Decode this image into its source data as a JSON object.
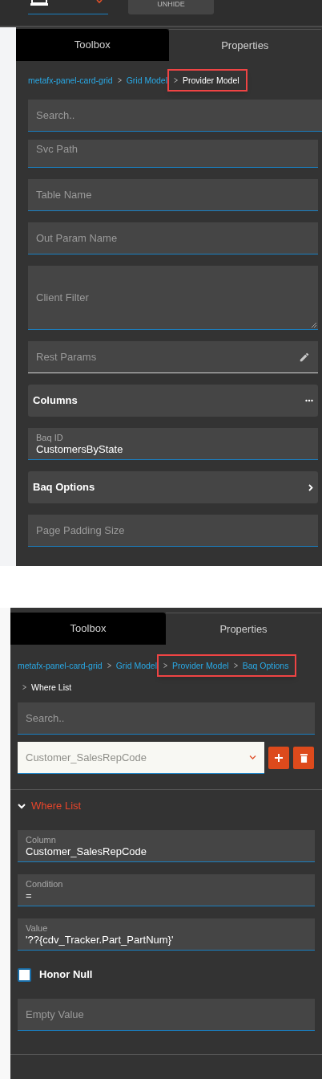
{
  "top_panel": {
    "toolbar": {
      "unhide_button": "UNHIDE"
    },
    "tabs": [
      {
        "label": "Toolbox",
        "selected": false
      },
      {
        "label": "Properties",
        "selected": true
      }
    ],
    "breadcrumbs": [
      {
        "label": "metafx-panel-card-grid",
        "current": false,
        "highlighted": false
      },
      {
        "label": "Grid Model",
        "current": false,
        "highlighted": false
      },
      {
        "label": "Provider Model",
        "current": true,
        "highlighted": true
      }
    ],
    "search": {
      "placeholder": "Search.."
    },
    "fields": [
      {
        "kind": "text",
        "placeholder": "Svc Path"
      },
      {
        "kind": "text",
        "placeholder": "Table Name"
      },
      {
        "kind": "text",
        "placeholder": "Out Param Name"
      },
      {
        "kind": "textarea",
        "placeholder": "Client Filter"
      },
      {
        "kind": "edit",
        "placeholder": "Rest Params"
      },
      {
        "kind": "more",
        "label": "Columns"
      },
      {
        "kind": "labeled",
        "label": "Baq ID",
        "value": "CustomersByState"
      },
      {
        "kind": "nav",
        "label": "Baq Options"
      },
      {
        "kind": "text",
        "placeholder": "Page Padding Size"
      }
    ]
  },
  "bottom_panel": {
    "tabs": [
      {
        "label": "Toolbox",
        "selected": false
      },
      {
        "label": "Properties",
        "selected": true
      }
    ],
    "breadcrumbs": [
      {
        "label": "metafx-panel-card-grid",
        "current": false,
        "highlighted": false
      },
      {
        "label": "Grid Model",
        "current": false,
        "highlighted": false
      },
      {
        "label": "Provider Model",
        "current": false,
        "highlighted": true
      },
      {
        "label": "Baq Options",
        "current": false,
        "highlighted": true
      },
      {
        "label": "Where List",
        "current": true,
        "highlighted": false
      }
    ],
    "search": {
      "placeholder": "Search.."
    },
    "selector": {
      "value": "Customer_SalesRepCode"
    },
    "section": {
      "title": "Where List",
      "expanded": true
    },
    "fields": [
      {
        "kind": "labeled",
        "label": "Column",
        "value": "Customer_SalesRepCode"
      },
      {
        "kind": "labeled",
        "label": "Condition",
        "value": "="
      },
      {
        "kind": "labeled",
        "label": "Value",
        "value": "'??{cdv_Tracker.Part_PartNum}'"
      },
      {
        "kind": "checkbox",
        "label": "Honor Null",
        "checked": false
      },
      {
        "kind": "text",
        "placeholder": "Empty Value"
      }
    ]
  }
}
